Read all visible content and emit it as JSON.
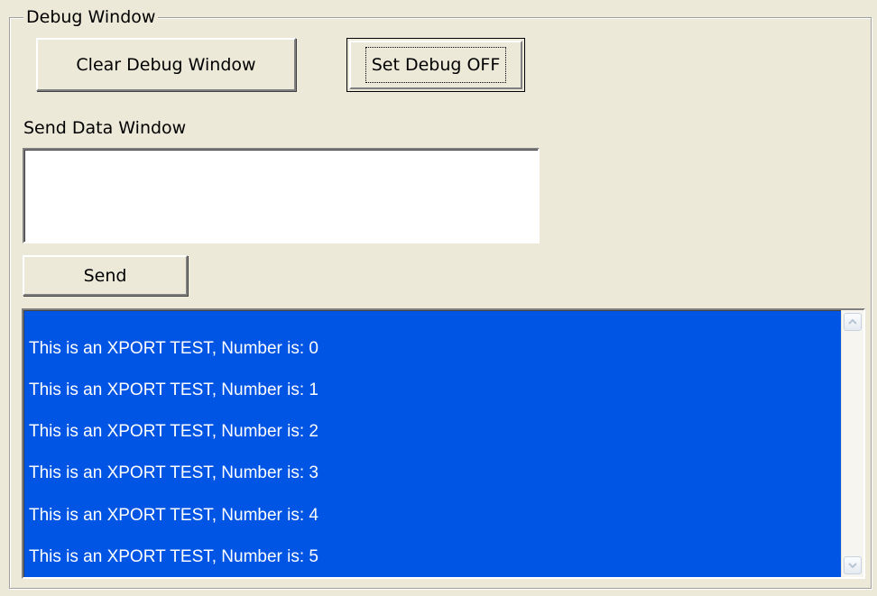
{
  "group": {
    "title": "Debug Window"
  },
  "buttons": {
    "clear_label": "Clear Debug Window",
    "debug_toggle_label": "Set Debug OFF",
    "send_label": "Send"
  },
  "send_window": {
    "label": "Send Data Window",
    "value": ""
  },
  "debug_output": {
    "lines": [
      "This is an XPORT TEST, Number is: 0",
      "This is an XPORT TEST, Number is: 1",
      "This is an XPORT TEST, Number is: 2",
      "This is an XPORT TEST, Number is: 3",
      "This is an XPORT TEST, Number is: 4",
      "This is an XPORT TEST, Number is: 5"
    ]
  },
  "icons": {
    "scroll_up": "chevron-up-icon",
    "scroll_down": "chevron-down-icon"
  },
  "colors": {
    "window_bg": "#ece9d8",
    "output_bg": "#0055e5",
    "output_text": "#ffffff"
  }
}
